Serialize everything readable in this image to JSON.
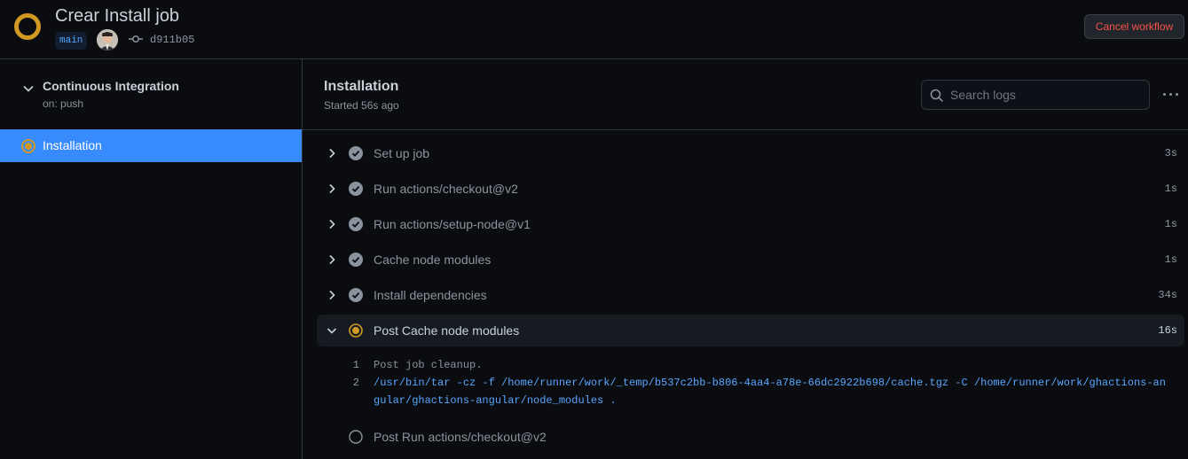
{
  "header": {
    "title": "Crear Install job",
    "branch": "main",
    "commit_sha": "d911b05",
    "cancel_label": "Cancel workflow",
    "status_color": "#d29922"
  },
  "sidebar": {
    "workflow_name": "Continuous Integration",
    "workflow_trigger": "on: push",
    "jobs": [
      {
        "label": "Installation",
        "status": "in_progress",
        "selected": true
      }
    ]
  },
  "main": {
    "job_title": "Installation",
    "job_started": "Started 56s ago",
    "search_placeholder": "Search logs",
    "steps": [
      {
        "label": "Set up job",
        "duration": "3s",
        "status": "success"
      },
      {
        "label": "Run actions/checkout@v2",
        "duration": "1s",
        "status": "success"
      },
      {
        "label": "Run actions/setup-node@v1",
        "duration": "1s",
        "status": "success"
      },
      {
        "label": "Cache node modules",
        "duration": "1s",
        "status": "success"
      },
      {
        "label": "Install dependencies",
        "duration": "34s",
        "status": "success"
      },
      {
        "label": "Post Cache node modules",
        "duration": "16s",
        "status": "in_progress",
        "expanded": true
      },
      {
        "label": "Post Run actions/checkout@v2",
        "duration": "",
        "status": "queued"
      }
    ],
    "log_lines": [
      {
        "num": "1",
        "text": "Post job cleanup."
      },
      {
        "num": "2",
        "text": "/usr/bin/tar -cz -f /home/runner/work/_temp/b537c2bb-b806-4aa4-a78e-66dc2922b698/cache.tgz -C /home/runner/work/ghactions-angular/ghactions-angular/node_modules ."
      }
    ]
  },
  "colors": {
    "accent": "#388bfd",
    "in_progress": "#d29922",
    "success_icon": "#8b949e",
    "danger": "#f85149",
    "link": "#58a6ff"
  }
}
